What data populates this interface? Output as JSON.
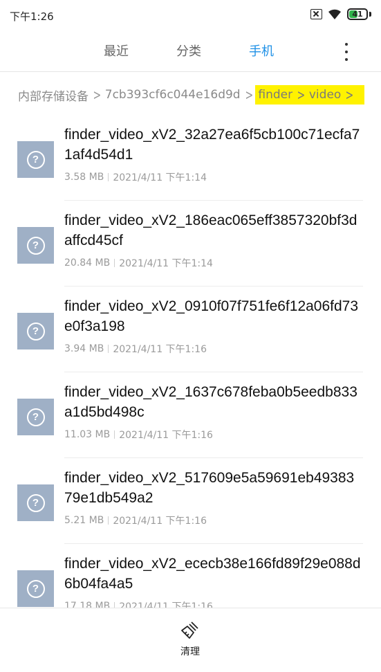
{
  "status_bar": {
    "time": "下午1:26",
    "battery": "41"
  },
  "tabs": [
    {
      "label": "最近",
      "active": false
    },
    {
      "label": "分类",
      "active": false
    },
    {
      "label": "手机",
      "active": true
    }
  ],
  "breadcrumb": [
    "内部存储设备",
    "7cb393cf6c044e16d9d",
    "finder",
    "video"
  ],
  "files": [
    {
      "name": "finder_video_xV2_32a27ea6f5cb100c71ecfa71af4d54d1",
      "size": "3.58 MB",
      "date": "2021/4/11 下午1:14"
    },
    {
      "name": "finder_video_xV2_186eac065eff3857320bf3daffcd45cf",
      "size": "20.84 MB",
      "date": "2021/4/11 下午1:14"
    },
    {
      "name": "finder_video_xV2_0910f07f751fe6f12a06fd73e0f3a198",
      "size": "3.94 MB",
      "date": "2021/4/11 下午1:16"
    },
    {
      "name": "finder_video_xV2_1637c678feba0b5eedb833a1d5bd498c",
      "size": "11.03 MB",
      "date": "2021/4/11 下午1:16"
    },
    {
      "name": "finder_video_xV2_517609e5a59691eb4938379e1db549a2",
      "size": "5.21 MB",
      "date": "2021/4/11 下午1:16"
    },
    {
      "name": "finder_video_xV2_ececb38e166fd89f29e088d6b04fa4a5",
      "size": "17.18 MB",
      "date": "2021/4/11 下午1:16"
    }
  ],
  "bottom_bar": {
    "clean_label": "清理"
  },
  "colors": {
    "accent": "#1e90e6",
    "highlight": "#fff200",
    "file_icon": "#9fb0c6"
  },
  "icons": {
    "file_icon": "question-mark-icon",
    "more": "more-vertical-icon",
    "clean": "broom-icon"
  }
}
